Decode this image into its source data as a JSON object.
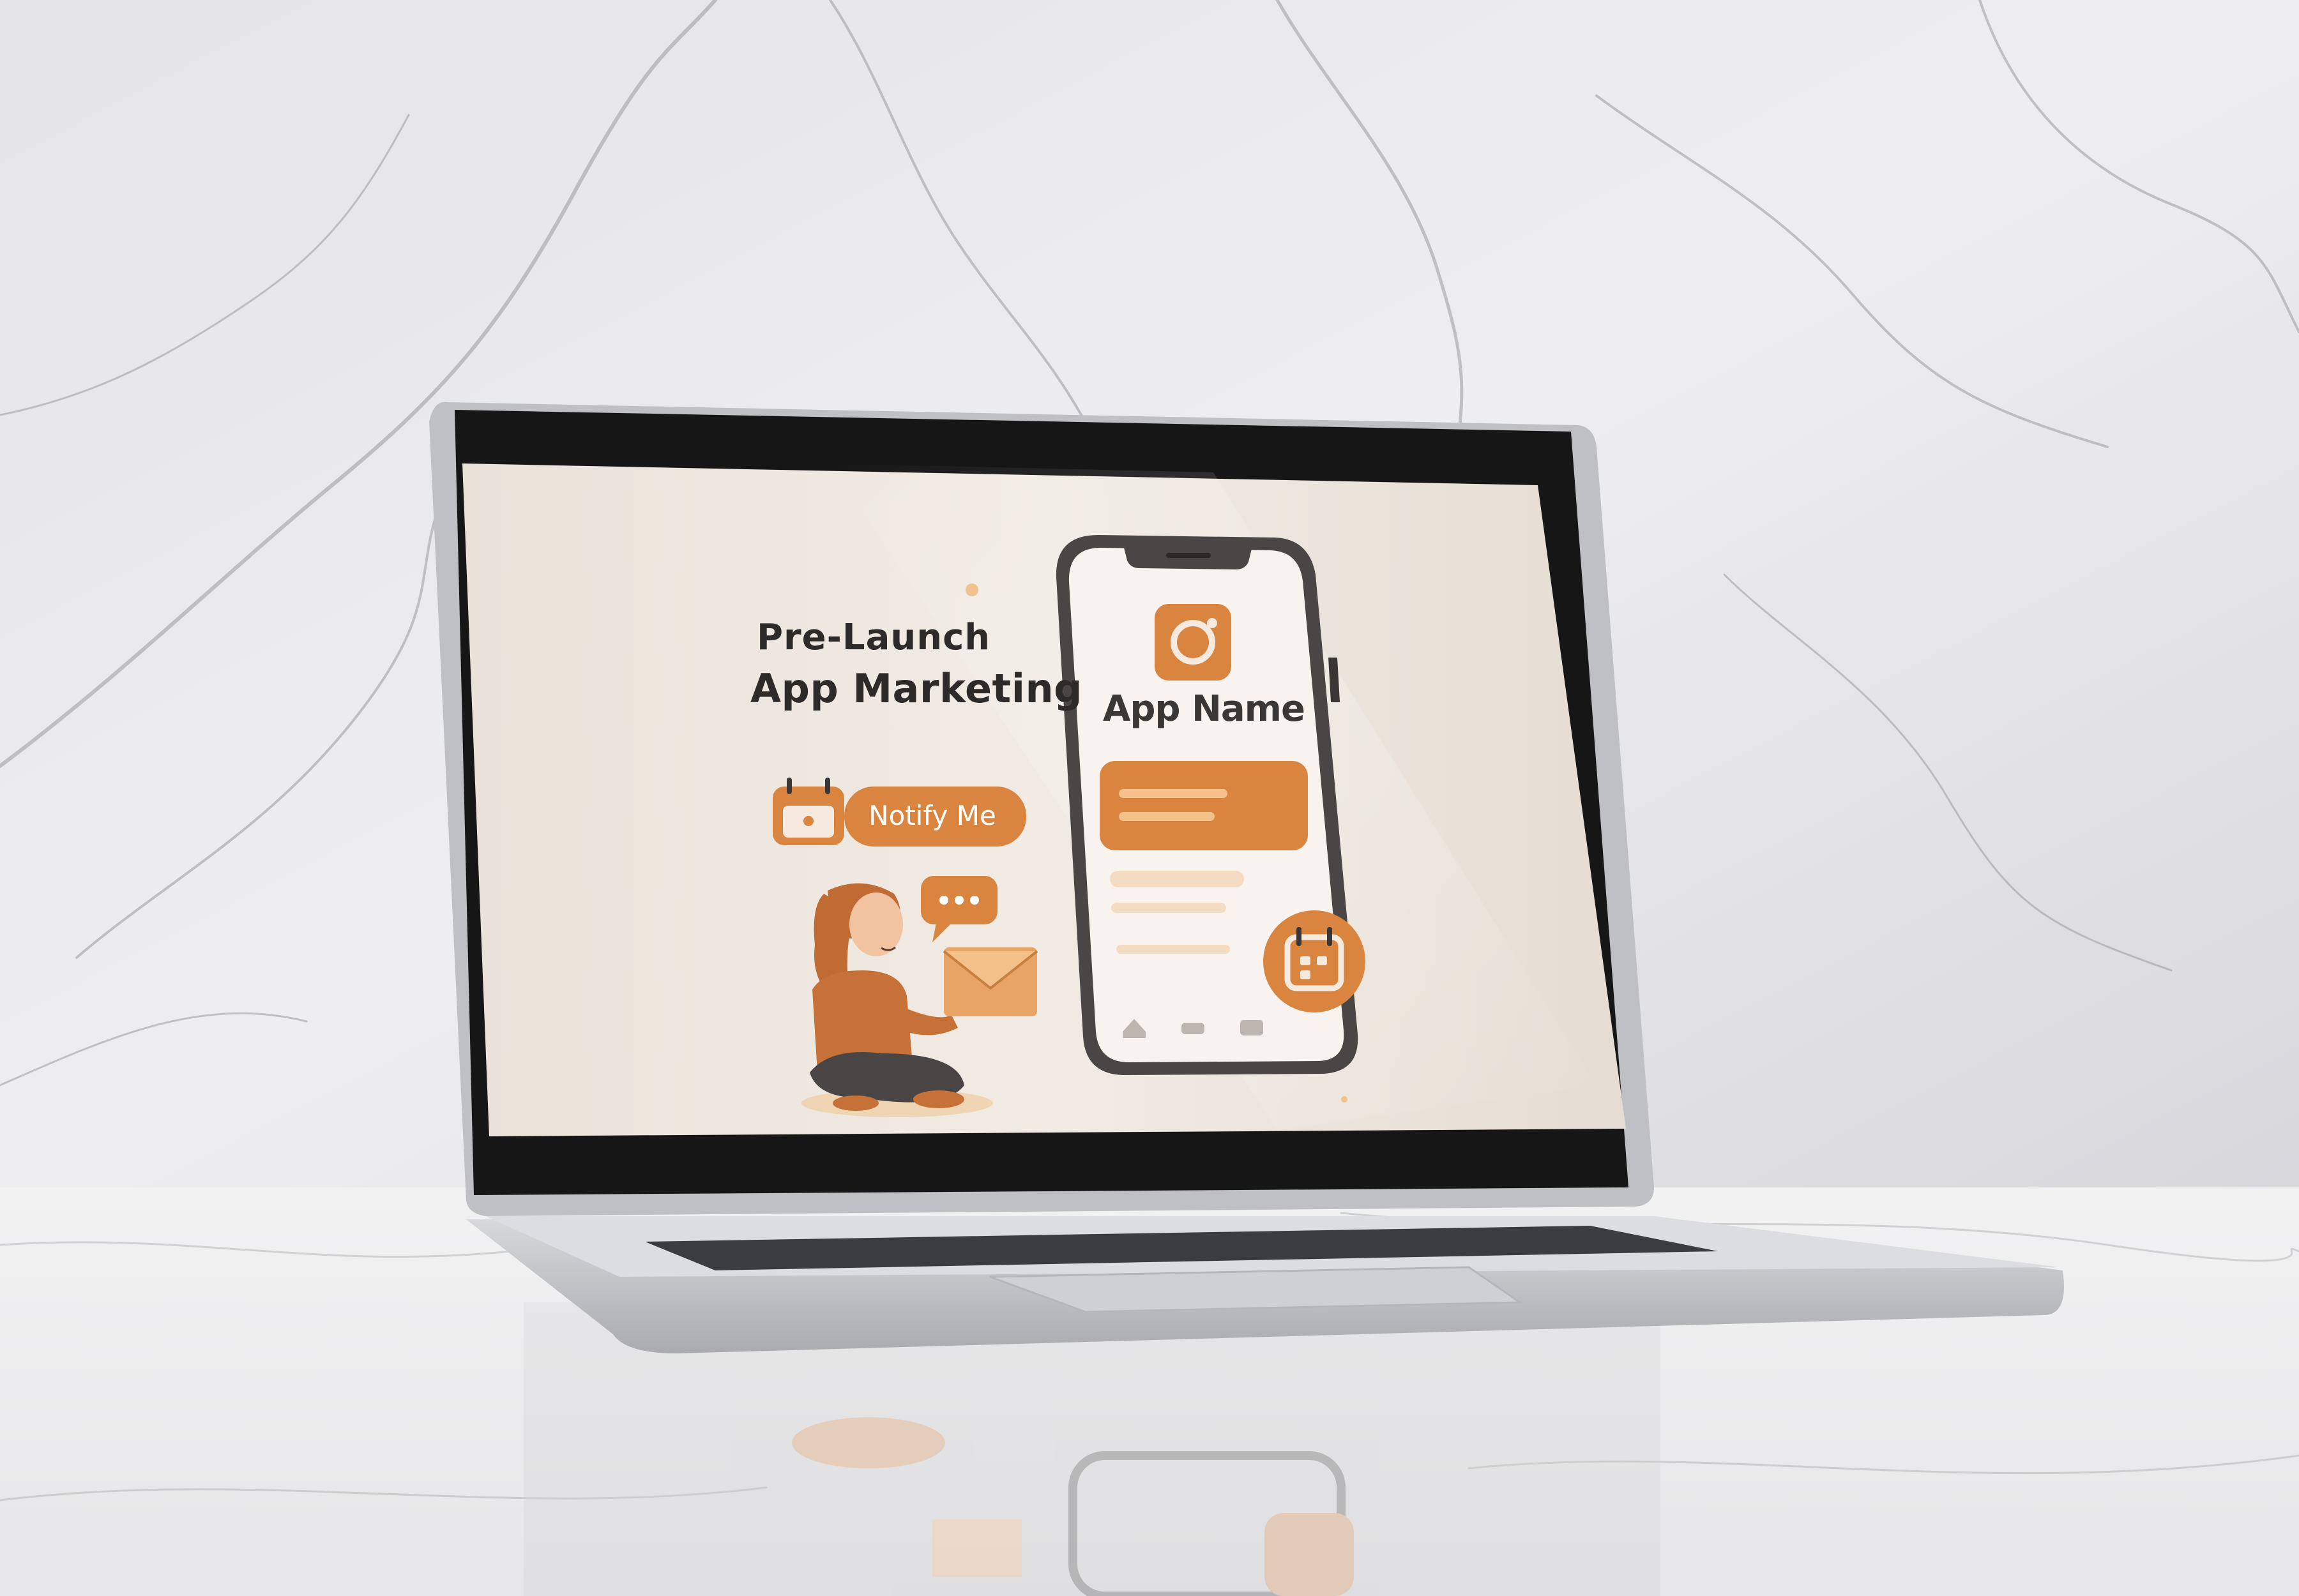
{
  "screen": {
    "title_line1": "Pre-Launch",
    "title_line2": "App Marketing",
    "notify_button_label": "Notify Me",
    "app_name": "App Name"
  },
  "colors": {
    "accent_orange": "#d9843f",
    "light_orange": "#f0b073",
    "screen_bg": "#ede5dc",
    "dark_text": "#2d2b2a",
    "laptop_silver": "#c9cacc",
    "bezel": "#161616"
  },
  "icons": [
    "calendar-icon",
    "camera-icon",
    "chat-bubble-icon",
    "envelope-icon",
    "home-icon"
  ]
}
